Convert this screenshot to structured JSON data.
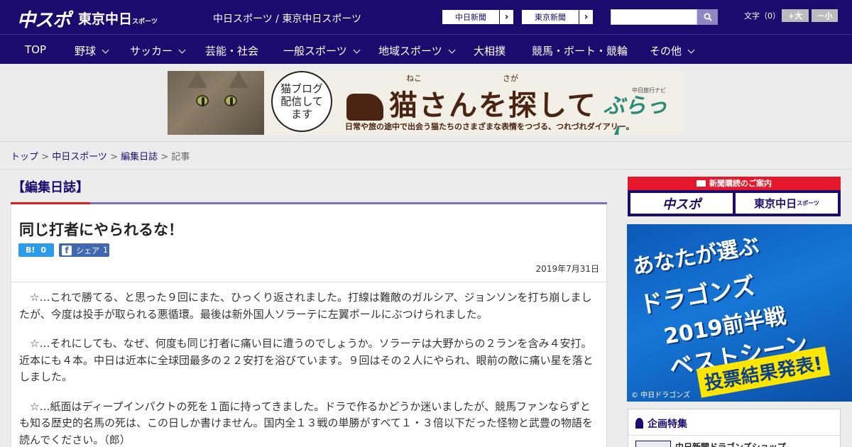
{
  "header": {
    "logo_main": "中スポ",
    "logo_sub": "東京中日",
    "logo_sub_small": "スポーツ",
    "links": "中日スポーツ / 東京中日スポーツ",
    "paper_buttons": [
      {
        "label": "中日新聞"
      },
      {
        "label": "東京新聞"
      }
    ],
    "search": {
      "placeholder": "",
      "value": ""
    },
    "font_size": {
      "label": "文字（0）",
      "larger": "+大",
      "smaller": "－小"
    }
  },
  "nav": {
    "items": [
      {
        "label": "TOP",
        "dropdown": false
      },
      {
        "label": "野球",
        "dropdown": true
      },
      {
        "label": "サッカー",
        "dropdown": true
      },
      {
        "label": "芸能・社会",
        "dropdown": false
      },
      {
        "label": "一般スポーツ",
        "dropdown": true
      },
      {
        "label": "地域スポーツ",
        "dropdown": true
      },
      {
        "label": "大相撲",
        "dropdown": false
      },
      {
        "label": "競馬・ボート・競輪",
        "dropdown": false
      },
      {
        "label": "その他",
        "dropdown": true
      }
    ]
  },
  "banner": {
    "bubble": "猫ブログ\n配信して\nます",
    "title": "猫さんを探して",
    "ruby_1": "ねこ",
    "ruby_2": "さが",
    "subtitle": "日常や旅の途中で出会う猫たちのさまざまな表情をつづる、つれづれダイアリー。",
    "brand": "ぶらっ人",
    "brand_small": "中日旅行ナビ"
  },
  "breadcrumb": {
    "items": [
      "トップ",
      "中日スポーツ",
      "編集日誌"
    ],
    "current": "記事"
  },
  "section": {
    "title": "【編集日誌】"
  },
  "article": {
    "title": "同じ打者にやられるな！",
    "hatena_count": "0",
    "facebook_label": "シェア",
    "facebook_count": "1",
    "date": "2019年7月31日",
    "paragraphs": [
      "　☆…これで勝てる、と思った９回にまた、ひっくり返されました。打線は難敵のガルシア、ジョンソンを打ち崩しましたが、今度は投手が取られる悪循環。最後は新外国人ソラーテに左翼ポールにぶつけられました。",
      "　☆…それにしても、なぜ、何度も同じ打者に痛い目に遭うのでしょうか。ソラーテは大野からの２ランを含み４安打。近本にも４本。中日は近本に全球団最多の２２安打を浴びています。９回はその２人にやられ、眼前の敵に痛い星を落としました。",
      "　☆…紙面はディープインパクトの死を１面に持ってきました。ドラで作るかどうか迷いましたが、競馬ファンならずとも知る歴史的名馬の死は、この日しか書けません。国内全１３戦の単勝がすべて１・３倍以下だった怪物と武豊の物語を読んでください。（郎）"
    ]
  },
  "sidebar": {
    "subscription": {
      "header": "新聞購読のご案内",
      "logo_1": "中スポ",
      "logo_2": "東京中日",
      "logo_2_small": "スポーツ"
    },
    "dragons_ad": {
      "line_1": "あなたが選ぶ",
      "line_2": "ドラゴンズ",
      "line_3": "2019前半戦",
      "line_4": "ベストシーン",
      "result": "投票結果発表!",
      "copyright": "© 中日ドラゴンズ"
    },
    "feature": {
      "title": "企画特集",
      "item": "中日新聞ドラゴンズショップ"
    }
  }
}
